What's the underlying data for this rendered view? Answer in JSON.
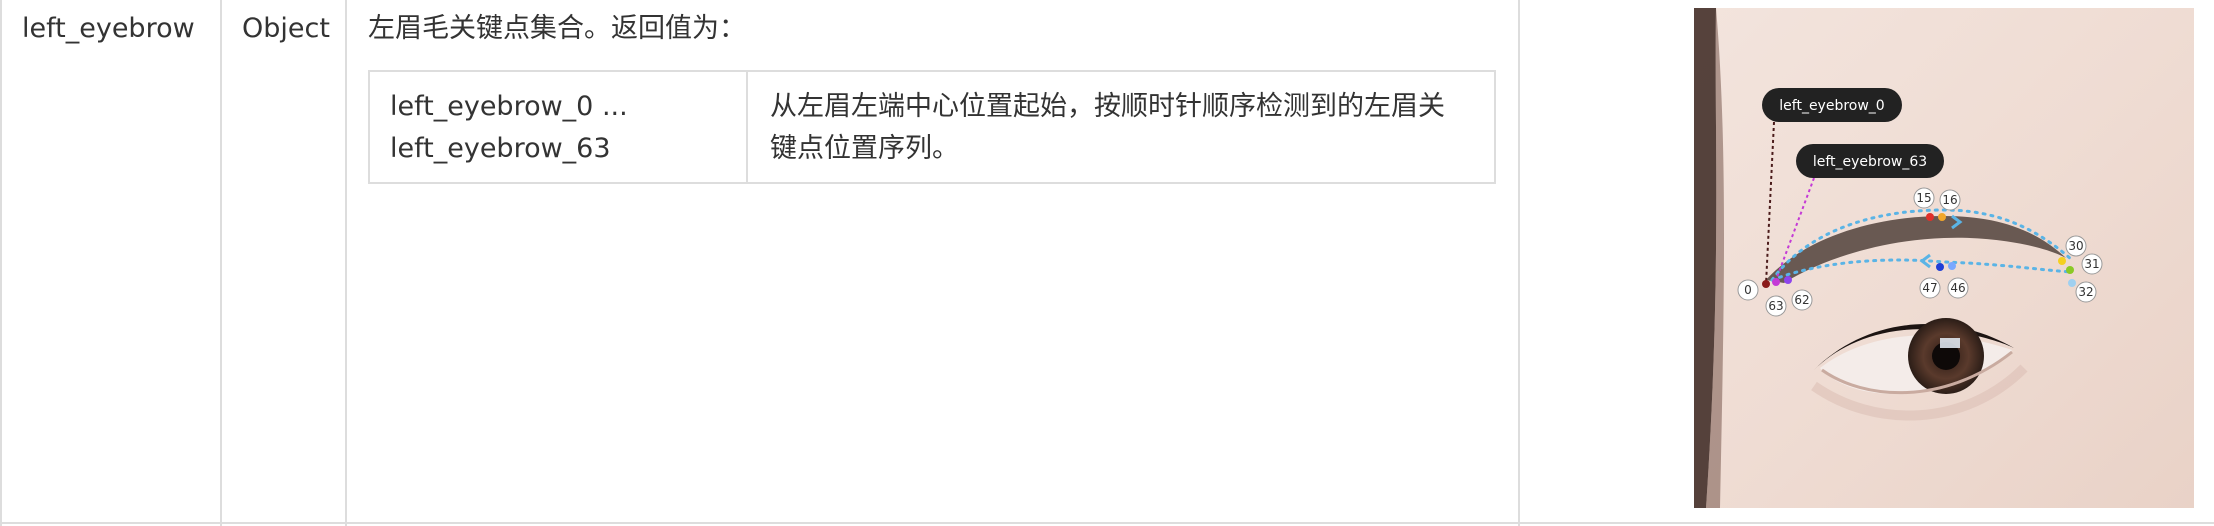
{
  "row": {
    "name": "left_eyebrow",
    "type": "Object",
    "description": "左眉毛关键点集合。返回值为："
  },
  "nested_table": {
    "key_line1": "left_eyebrow_0 ...",
    "key_line2": "left_eyebrow_63",
    "desc_line1": "从左眉左端中心位置起始，按顺时针顺序检测到的左眉关",
    "desc_line2": "键点位置序列。"
  },
  "illustration": {
    "callouts": [
      "left_eyebrow_0",
      "left_eyebrow_63"
    ],
    "point_labels": [
      "0",
      "63",
      "62",
      "15",
      "16",
      "30",
      "31",
      "32",
      "47",
      "46"
    ],
    "colors": {
      "callout_bg": "#222222",
      "dotted_path": "#5ab4e6",
      "point_0": "#8b1a1a",
      "point_63": "#c43ad6",
      "point_15": "#e0302a",
      "point_16": "#f2a72a",
      "point_30": "#f5d020",
      "point_31": "#8ac926",
      "point_47": "#1f3fd6"
    }
  }
}
